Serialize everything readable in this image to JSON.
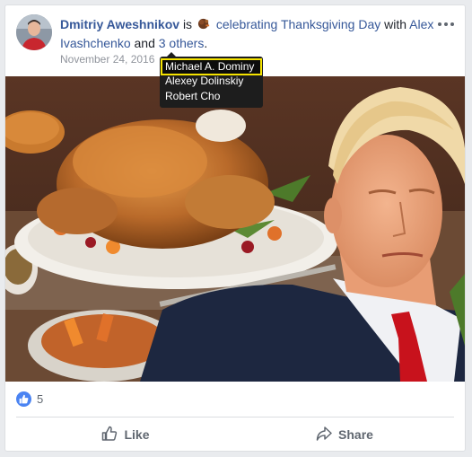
{
  "post": {
    "author": "Dmitriy Aweshnikov",
    "is_text": "is",
    "activity_emoji_icon": "turkey-icon",
    "activity_text": "celebrating Thanksgiving Day",
    "with_text": "with",
    "tagged_person": "Alex Ivashchenko",
    "and_text": "and",
    "others_link": "3 others",
    "period": ".",
    "date": "November 24, 2016"
  },
  "tooltip": {
    "names": [
      "Michael A. Dominy",
      "Alexey Dolinskiy",
      "Robert Cho"
    ],
    "highlight_color": "#f5e300"
  },
  "reactions": {
    "icon": "thumbs-up-icon",
    "count": "5"
  },
  "actions": {
    "like_label": "Like",
    "share_label": "Share"
  },
  "colors": {
    "link": "#365899",
    "muted": "#90949c",
    "like_blue": "#4a83f2"
  }
}
